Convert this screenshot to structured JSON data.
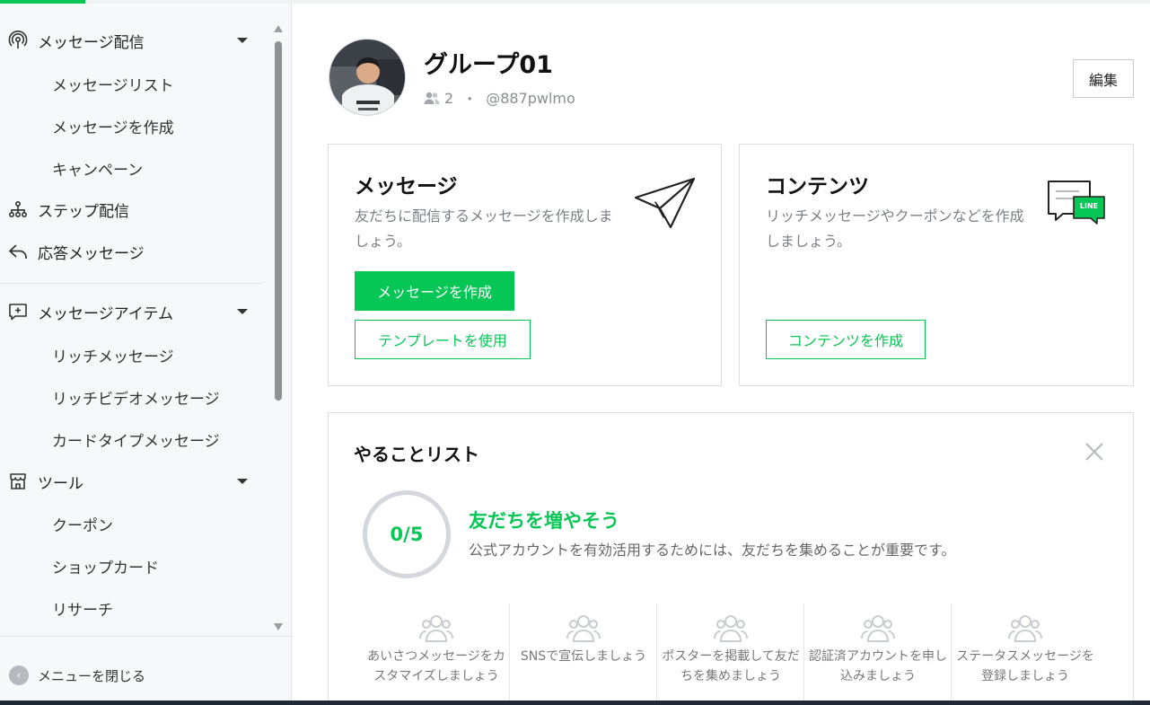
{
  "colors": {
    "brand_green": "#06c755",
    "sidebar_bg": "#f7f8fa",
    "text_muted": "#7b7f85"
  },
  "sidebar": {
    "sections": [
      {
        "label": "メッセージ配信",
        "icon": "broadcast-icon",
        "expanded": true,
        "children": [
          "メッセージリスト",
          "メッセージを作成",
          "キャンペーン"
        ]
      },
      {
        "label": "ステップ配信",
        "icon": "step-flow-icon"
      },
      {
        "label": "応答メッセージ",
        "icon": "reply-arrow-icon"
      },
      {
        "label": "メッセージアイテム",
        "icon": "message-plus-icon",
        "expanded": true,
        "children": [
          "リッチメッセージ",
          "リッチビデオメッセージ",
          "カードタイプメッセージ"
        ]
      },
      {
        "label": "ツール",
        "icon": "shop-icon",
        "expanded": true,
        "children": [
          "クーポン",
          "ショップカード",
          "リサーチ"
        ]
      }
    ],
    "close_menu_label": "メニューを閉じる"
  },
  "account": {
    "name": "グループ01",
    "friend_count": "2",
    "separator": "・",
    "handle": "@887pwlmo",
    "edit_label": "編集"
  },
  "cards": {
    "message": {
      "title": "メッセージ",
      "description": "友だちに配信するメッセージを作成しましょう。",
      "primary_button": "メッセージを作成",
      "secondary_button": "テンプレートを使用",
      "icon": "paper-plane-icon"
    },
    "content": {
      "title": "コンテンツ",
      "description": "リッチメッセージやクーポンなどを作成しましょう。",
      "button": "コンテンツを作成",
      "icon": "line-chat-icon",
      "icon_badge_text": "LINE"
    }
  },
  "todo": {
    "title": "やることリスト",
    "progress": "0/5",
    "goal_title": "友だちを増やそう",
    "goal_description": "公式アカウントを有効活用するためには、友だちを集めることが重要です。",
    "tasks": [
      {
        "label": "あいさつメッセージをカスタマイズしましょう",
        "icon": "friends-icon"
      },
      {
        "label": "SNSで宣伝しましょう",
        "icon": "friends-icon"
      },
      {
        "label": "ポスターを掲載して友だちを集めましょう",
        "icon": "friends-icon"
      },
      {
        "label": "認証済アカウントを申し込みましょう",
        "icon": "friends-icon"
      },
      {
        "label": "ステータスメッセージを登録しましょう",
        "icon": "friends-icon"
      }
    ]
  }
}
